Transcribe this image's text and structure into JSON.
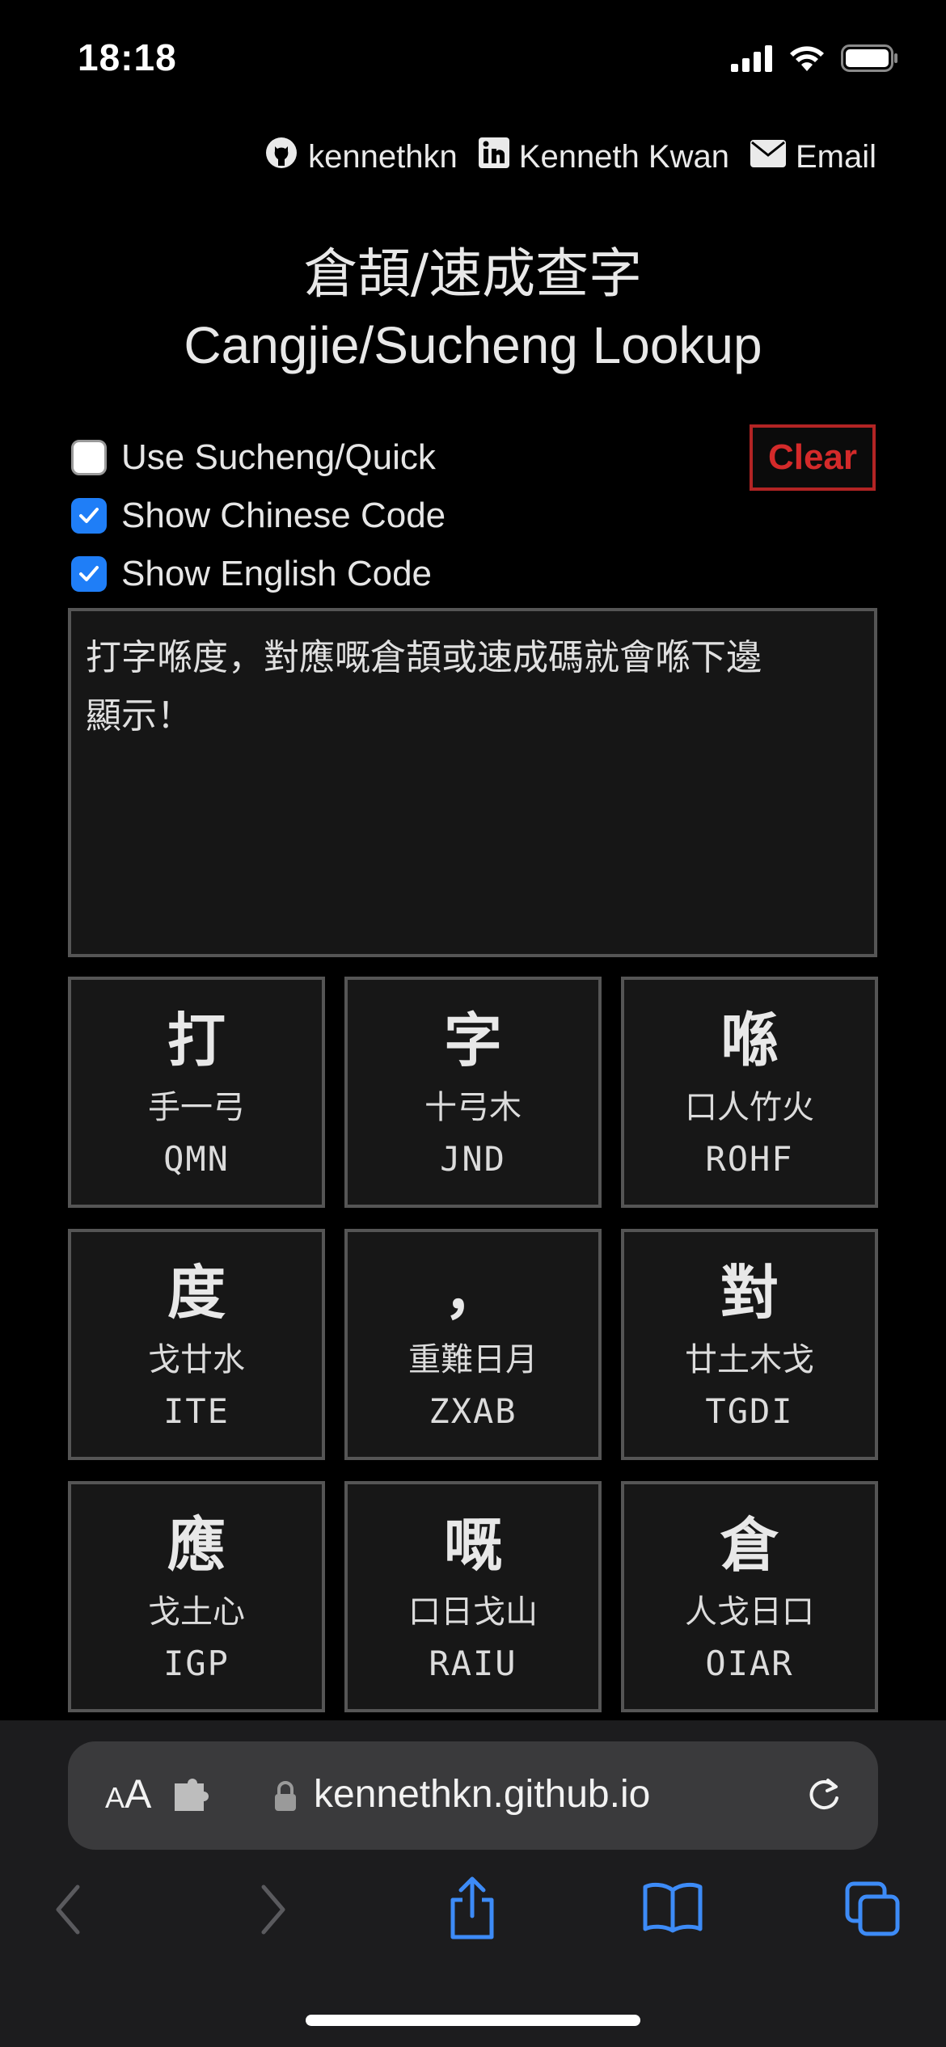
{
  "status_bar": {
    "time": "18:18"
  },
  "links": {
    "github": "kennethkn",
    "linkedin": "Kenneth Kwan",
    "email": "Email"
  },
  "title": {
    "zh": "倉頡/速成查字",
    "en": "Cangjie/Sucheng Lookup"
  },
  "options": {
    "sucheng": {
      "label": "Use Sucheng/Quick",
      "checked": false
    },
    "chinese_code": {
      "label": "Show Chinese Code",
      "checked": true
    },
    "english_code": {
      "label": "Show English Code",
      "checked": true
    }
  },
  "clear_label": "Clear",
  "input": {
    "placeholder": "打字喺度，對應嘅倉頡或速成碼就會喺下邊顯示！",
    "line1": "打字喺度，對應嘅倉頡或速成碼就會喺下邊",
    "line2": "顯示！"
  },
  "cards": [
    {
      "char": "打",
      "zh": "手一弓",
      "en": "QMN"
    },
    {
      "char": "字",
      "zh": "十弓木",
      "en": "JND"
    },
    {
      "char": "喺",
      "zh": "口人竹火",
      "en": "ROHF"
    },
    {
      "char": "度",
      "zh": "戈廿水",
      "en": "ITE"
    },
    {
      "char": "，",
      "zh": "重難日月",
      "en": "ZXAB"
    },
    {
      "char": "對",
      "zh": "廿土木戈",
      "en": "TGDI"
    },
    {
      "char": "應",
      "zh": "戈土心",
      "en": "IGP"
    },
    {
      "char": "嘅",
      "zh": "口日戈山",
      "en": "RAIU"
    },
    {
      "char": "倉",
      "zh": "人戈日口",
      "en": "OIAR"
    }
  ],
  "browser": {
    "aa_small": "A",
    "aa_large": "A",
    "url": "kennethkn.github.io"
  },
  "icons": {
    "signal": "signal-icon",
    "wifi": "wifi-icon",
    "battery": "battery-icon",
    "github": "github-icon",
    "linkedin": "linkedin-icon",
    "email": "envelope-icon",
    "lock": "lock-icon",
    "reload": "reload-icon",
    "extension": "extension-icon",
    "back": "back-chevron-icon",
    "forward": "forward-chevron-icon",
    "share": "share-icon",
    "bookmarks": "book-icon",
    "tabs": "tabs-icon"
  },
  "colors": {
    "accent": "#1f7ef7",
    "clear": "#d42a2a"
  }
}
